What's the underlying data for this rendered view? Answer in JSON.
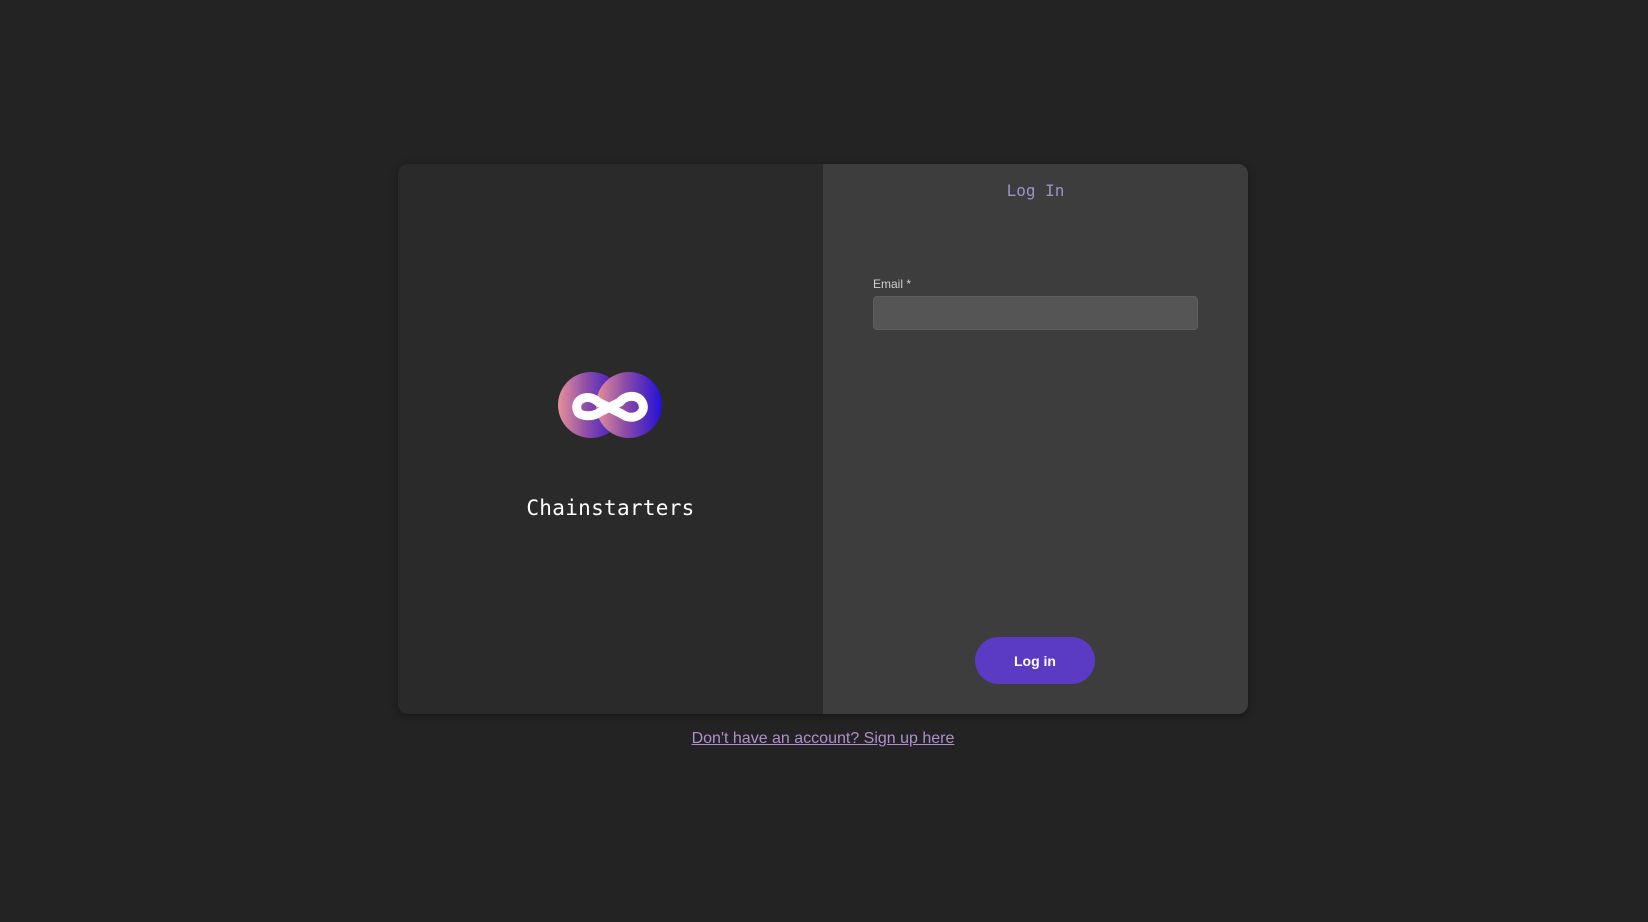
{
  "brand": {
    "name": "Chainstarters",
    "logo_icon": "infinity-loop-logo-icon"
  },
  "form": {
    "title": "Log In",
    "email_label": "Email *",
    "email_value": "",
    "email_placeholder": "",
    "submit_label": "Log in"
  },
  "footer": {
    "signup_link": "Don't have an account? Sign up here"
  },
  "colors": {
    "background": "#232323",
    "brand_panel": "#2a2a2a",
    "form_panel": "#3d3d3d",
    "accent_button": "#5b3ac4",
    "title_text": "#9f91c4",
    "link_text": "#b08fd0",
    "logo_gradient_start": "#e6919b",
    "logo_gradient_end": "#2310d8"
  }
}
